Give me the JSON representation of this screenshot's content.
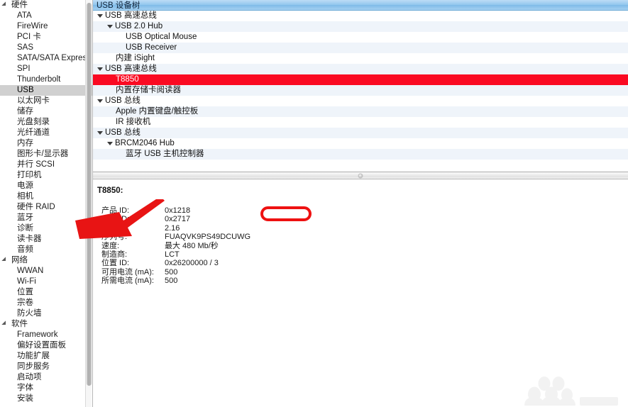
{
  "sidebar": {
    "groups": [
      {
        "label": "硬件",
        "expanded": true,
        "items": [
          {
            "label": "ATA",
            "selected": false
          },
          {
            "label": "FireWire",
            "selected": false
          },
          {
            "label": "PCI 卡",
            "selected": false
          },
          {
            "label": "SAS",
            "selected": false
          },
          {
            "label": "SATA/SATA Express",
            "selected": false
          },
          {
            "label": "SPI",
            "selected": false
          },
          {
            "label": "Thunderbolt",
            "selected": false
          },
          {
            "label": "USB",
            "selected": true
          },
          {
            "label": "以太网卡",
            "selected": false
          },
          {
            "label": "储存",
            "selected": false
          },
          {
            "label": "光盘刻录",
            "selected": false
          },
          {
            "label": "光纤通道",
            "selected": false
          },
          {
            "label": "内存",
            "selected": false
          },
          {
            "label": "图形卡/显示器",
            "selected": false
          },
          {
            "label": "并行 SCSI",
            "selected": false
          },
          {
            "label": "打印机",
            "selected": false
          },
          {
            "label": "电源",
            "selected": false
          },
          {
            "label": "相机",
            "selected": false
          },
          {
            "label": "硬件 RAID",
            "selected": false
          },
          {
            "label": "蓝牙",
            "selected": false
          },
          {
            "label": "诊断",
            "selected": false
          },
          {
            "label": "读卡器",
            "selected": false
          },
          {
            "label": "音频",
            "selected": false
          }
        ]
      },
      {
        "label": "网络",
        "expanded": true,
        "items": [
          {
            "label": "WWAN",
            "selected": false
          },
          {
            "label": "Wi-Fi",
            "selected": false
          },
          {
            "label": "位置",
            "selected": false
          },
          {
            "label": "宗卷",
            "selected": false
          },
          {
            "label": "防火墙",
            "selected": false
          }
        ]
      },
      {
        "label": "软件",
        "expanded": true,
        "items": [
          {
            "label": "Framework",
            "selected": false
          },
          {
            "label": "偏好设置面板",
            "selected": false
          },
          {
            "label": "功能扩展",
            "selected": false
          },
          {
            "label": "同步服务",
            "selected": false
          },
          {
            "label": "启动项",
            "selected": false
          },
          {
            "label": "字体",
            "selected": false
          },
          {
            "label": "安装",
            "selected": false
          }
        ]
      }
    ]
  },
  "tree": {
    "header": "USB 设备树",
    "rows": [
      {
        "label": "USB 高速总线",
        "depth": 0,
        "twisty": true,
        "selected": false
      },
      {
        "label": "USB 2.0 Hub",
        "depth": 1,
        "twisty": true,
        "selected": false
      },
      {
        "label": "USB Optical Mouse",
        "depth": 2,
        "twisty": false,
        "selected": false
      },
      {
        "label": "USB Receiver",
        "depth": 2,
        "twisty": false,
        "selected": false
      },
      {
        "label": "内建 iSight",
        "depth": 1,
        "twisty": false,
        "selected": false
      },
      {
        "label": "USB 高速总线",
        "depth": 0,
        "twisty": true,
        "selected": false
      },
      {
        "label": "T8850",
        "depth": 1,
        "twisty": false,
        "selected": true
      },
      {
        "label": "内置存储卡阅读器",
        "depth": 1,
        "twisty": false,
        "selected": false
      },
      {
        "label": "USB 总线",
        "depth": 0,
        "twisty": true,
        "selected": false
      },
      {
        "label": "Apple 内置键盘/触控板",
        "depth": 1,
        "twisty": false,
        "selected": false
      },
      {
        "label": "IR 接收机",
        "depth": 1,
        "twisty": false,
        "selected": false
      },
      {
        "label": "USB 总线",
        "depth": 0,
        "twisty": true,
        "selected": false
      },
      {
        "label": "BRCM2046 Hub",
        "depth": 1,
        "twisty": true,
        "selected": false
      },
      {
        "label": "蓝牙 USB 主机控制器",
        "depth": 2,
        "twisty": false,
        "selected": false
      }
    ]
  },
  "detail": {
    "title": "T8850:",
    "properties": [
      {
        "label": "产品 ID:",
        "value": "0x1218"
      },
      {
        "label": "厂商 ID:",
        "value": "0x2717"
      },
      {
        "label": "版本:",
        "value": "2.16"
      },
      {
        "label": "序列号:",
        "value": "FUAQVK9PS49DCUWG"
      },
      {
        "label": "速度:",
        "value": "最大 480 Mb/秒"
      },
      {
        "label": "制造商:",
        "value": "LCT"
      },
      {
        "label": "位置 ID:",
        "value": "0x26200000 / 3"
      },
      {
        "label": "可用电流 (mA):",
        "value": "500"
      },
      {
        "label": "所需电流 (mA):",
        "value": "500"
      }
    ]
  },
  "annotations": {
    "highlight_color": "#ee1111",
    "highlighted_value": "0x2717",
    "arrow_target": "厂商 ID:"
  },
  "colors": {
    "selected_row": "#fa0a22",
    "header_blue": "#93c7ee",
    "sidebar_selection": "#d0d0d0",
    "stripe": "#eff4fa"
  }
}
